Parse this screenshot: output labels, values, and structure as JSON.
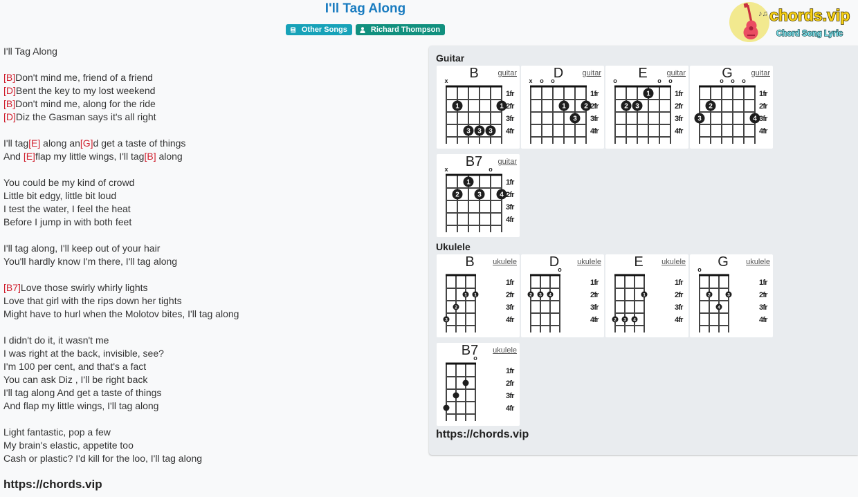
{
  "header": {
    "title": "I'll Tag Along",
    "badges": [
      {
        "label": "Other Songs",
        "icon": "book-icon",
        "color": "#17a2b8"
      },
      {
        "label": "Richard Thompson",
        "icon": "user-icon",
        "color": "#11907e"
      }
    ]
  },
  "logo": {
    "brand": "chords.vip",
    "tagline": "Chord Song Lyric",
    "icon": "guitar-icon"
  },
  "colors": {
    "title": "#1a7cc0",
    "chord": "#d0202e",
    "text": "#333333",
    "panel_bg": "#e9ecef",
    "page_bg": "#f8f9fa"
  },
  "lyrics": {
    "chord_open": "[",
    "chord_close": "]",
    "lines": [
      [
        {
          "text": "I'll Tag Along"
        }
      ],
      [],
      [
        {
          "chord": "B"
        },
        {
          "text": "Don't mind me, friend of a friend"
        }
      ],
      [
        {
          "chord": "D"
        },
        {
          "text": "Bent the key to my lost weekend"
        }
      ],
      [
        {
          "chord": "B"
        },
        {
          "text": "Don't mind me, along for the ride"
        }
      ],
      [
        {
          "chord": "D"
        },
        {
          "text": "Diz the Gasman says it's all right"
        }
      ],
      [],
      [
        {
          "text": "I'll tag"
        },
        {
          "chord": "E"
        },
        {
          "text": " along an"
        },
        {
          "chord": "G"
        },
        {
          "text": "d get a taste of things"
        }
      ],
      [
        {
          "text": "And "
        },
        {
          "chord": "E"
        },
        {
          "text": "flap my little wings, I'll tag"
        },
        {
          "chord": "B"
        },
        {
          "text": " along"
        }
      ],
      [],
      [
        {
          "text": "You could be my kind of crowd"
        }
      ],
      [
        {
          "text": "Little bit edgy, little bit loud"
        }
      ],
      [
        {
          "text": "I test the water, I feel the heat"
        }
      ],
      [
        {
          "text": "Before I jump in with both feet"
        }
      ],
      [],
      [
        {
          "text": "I'll tag along, I'll keep out of your hair"
        }
      ],
      [
        {
          "text": "You'll hardly know I'm there, I'll tag along"
        }
      ],
      [],
      [
        {
          "chord": "B7"
        },
        {
          "text": "Love those swirly whirly lights"
        }
      ],
      [
        {
          "text": "Love that girl with the rips down her tights"
        }
      ],
      [
        {
          "text": "Might have to hurl when the Molotov bites, I'll tag along"
        }
      ],
      [],
      [
        {
          "text": "I didn't do it, it wasn't me"
        }
      ],
      [
        {
          "text": "I was right at the back, invisible, see?"
        }
      ],
      [
        {
          "text": "I'm 100 per cent, and that's a fact"
        }
      ],
      [
        {
          "text": "You can ask Diz , I'll be right back"
        }
      ],
      [
        {
          "text": "I'll tag along And get a taste of things"
        }
      ],
      [
        {
          "text": "And flap my little wings, I'll tag along"
        }
      ],
      [],
      [
        {
          "text": "Light fantastic, pop a few"
        }
      ],
      [
        {
          "text": "My brain's elastic, appetite too"
        }
      ],
      [
        {
          "text": "Cash or plastic? I'd kill for the loo, I'll tag along"
        }
      ]
    ],
    "footer_url": "https://chords.vip"
  },
  "diagrams": {
    "fret_labels": [
      "1fr",
      "2fr",
      "3fr",
      "4fr"
    ],
    "guitar": {
      "heading": "Guitar",
      "chords": [
        {
          "name": "B",
          "link": "guitar",
          "markers": [
            "x",
            "",
            "",
            "",
            "",
            ""
          ],
          "dots": [
            {
              "string": 2,
              "fret": 2,
              "finger": "1"
            },
            {
              "string": 6,
              "fret": 2,
              "finger": "1"
            },
            {
              "string": 3,
              "fret": 4,
              "finger": "3"
            },
            {
              "string": 4,
              "fret": 4,
              "finger": "3"
            },
            {
              "string": 5,
              "fret": 4,
              "finger": "3"
            }
          ]
        },
        {
          "name": "D",
          "link": "guitar",
          "markers": [
            "x",
            "o",
            "o",
            "",
            "",
            ""
          ],
          "dots": [
            {
              "string": 4,
              "fret": 2,
              "finger": "1"
            },
            {
              "string": 6,
              "fret": 2,
              "finger": "2"
            },
            {
              "string": 5,
              "fret": 3,
              "finger": "3"
            }
          ]
        },
        {
          "name": "E",
          "link": "guitar",
          "markers": [
            "o",
            "",
            "",
            "",
            "o",
            "o"
          ],
          "dots": [
            {
              "string": 4,
              "fret": 1,
              "finger": "1"
            },
            {
              "string": 2,
              "fret": 2,
              "finger": "2"
            },
            {
              "string": 3,
              "fret": 2,
              "finger": "3"
            }
          ]
        },
        {
          "name": "G",
          "link": "guitar",
          "markers": [
            "",
            "",
            "o",
            "o",
            "o",
            ""
          ],
          "dots": [
            {
              "string": 2,
              "fret": 2,
              "finger": "2"
            },
            {
              "string": 1,
              "fret": 3,
              "finger": "3"
            },
            {
              "string": 6,
              "fret": 3,
              "finger": "4"
            }
          ]
        },
        {
          "name": "B7",
          "link": "guitar",
          "markers": [
            "x",
            "",
            "",
            "",
            "o",
            ""
          ],
          "dots": [
            {
              "string": 3,
              "fret": 1,
              "finger": "1"
            },
            {
              "string": 2,
              "fret": 2,
              "finger": "2"
            },
            {
              "string": 4,
              "fret": 2,
              "finger": "3"
            },
            {
              "string": 6,
              "fret": 2,
              "finger": "4"
            }
          ]
        }
      ]
    },
    "ukulele": {
      "heading": "Ukulele",
      "chords": [
        {
          "name": "B",
          "link": "ukulele",
          "markers": [
            "",
            "",
            "",
            ""
          ],
          "dots": [
            {
              "string": 3,
              "fret": 2,
              "finger": "1"
            },
            {
              "string": 4,
              "fret": 2,
              "finger": "1"
            },
            {
              "string": 2,
              "fret": 3,
              "finger": "2"
            },
            {
              "string": 1,
              "fret": 4,
              "finger": "3"
            }
          ]
        },
        {
          "name": "D",
          "link": "ukulele",
          "markers": [
            "",
            "",
            "",
            "o"
          ],
          "dots": [
            {
              "string": 1,
              "fret": 2,
              "finger": "2"
            },
            {
              "string": 2,
              "fret": 2,
              "finger": "3"
            },
            {
              "string": 3,
              "fret": 2,
              "finger": "4"
            }
          ]
        },
        {
          "name": "E",
          "link": "ukulele",
          "markers": [
            "",
            "",
            "",
            ""
          ],
          "dots": [
            {
              "string": 4,
              "fret": 2,
              "finger": "1"
            },
            {
              "string": 1,
              "fret": 4,
              "finger": "2"
            },
            {
              "string": 2,
              "fret": 4,
              "finger": "3"
            },
            {
              "string": 3,
              "fret": 4,
              "finger": "4"
            }
          ]
        },
        {
          "name": "G",
          "link": "ukulele",
          "markers": [
            "o",
            "",
            "",
            ""
          ],
          "dots": [
            {
              "string": 2,
              "fret": 2,
              "finger": "2"
            },
            {
              "string": 4,
              "fret": 2,
              "finger": "3"
            },
            {
              "string": 3,
              "fret": 3,
              "finger": "4"
            }
          ]
        },
        {
          "name": "B7",
          "link": "ukulele",
          "markers": [
            "",
            "",
            "",
            "o"
          ],
          "dots": [
            {
              "string": 3,
              "fret": 2,
              "finger": ""
            },
            {
              "string": 2,
              "fret": 3,
              "finger": ""
            },
            {
              "string": 1,
              "fret": 4,
              "finger": ""
            }
          ]
        }
      ]
    },
    "footer_url": "https://chords.vip"
  }
}
